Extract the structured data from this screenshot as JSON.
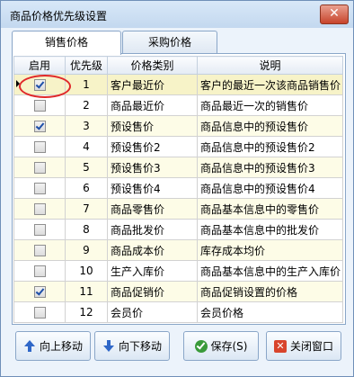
{
  "window": {
    "title": "商品价格优先级设置",
    "close_glyph": "✕"
  },
  "tabs": [
    {
      "label": "销售价格",
      "active": true
    },
    {
      "label": "采购价格",
      "active": false
    }
  ],
  "grid": {
    "columns": [
      "启用",
      "优先级",
      "价格类别",
      "说明"
    ],
    "rows": [
      {
        "enabled": true,
        "priority": "1",
        "category": "客户最近价",
        "description": "客户的最近一次该商品销售价",
        "selected": true
      },
      {
        "enabled": false,
        "priority": "2",
        "category": "商品最近价",
        "description": "商品最近一次的销售价"
      },
      {
        "enabled": true,
        "priority": "3",
        "category": "预设售价",
        "description": "商品信息中的预设售价"
      },
      {
        "enabled": false,
        "priority": "4",
        "category": "预设售价2",
        "description": "商品信息中的预设售价2"
      },
      {
        "enabled": false,
        "priority": "5",
        "category": "预设售价3",
        "description": "商品信息中的预设售价3"
      },
      {
        "enabled": false,
        "priority": "6",
        "category": "预设售价4",
        "description": "商品信息中的预设售价4"
      },
      {
        "enabled": false,
        "priority": "7",
        "category": "商品零售价",
        "description": "商品基本信息中的零售价"
      },
      {
        "enabled": false,
        "priority": "8",
        "category": "商品批发价",
        "description": "商品基本信息中的批发价"
      },
      {
        "enabled": false,
        "priority": "9",
        "category": "商品成本价",
        "description": "库存成本均价"
      },
      {
        "enabled": false,
        "priority": "10",
        "category": "生产入库价",
        "description": "商品基本信息中的生产入库价"
      },
      {
        "enabled": true,
        "priority": "11",
        "category": "商品促销价",
        "description": "商品促销设置的价格"
      },
      {
        "enabled": false,
        "priority": "12",
        "category": "会员价",
        "description": "会员价格"
      }
    ]
  },
  "buttons": {
    "move_up": "向上移动",
    "move_down": "向下移动",
    "save": "保存(S)",
    "close": "关闭窗口"
  },
  "colors": {
    "accent": "#2f67c8",
    "annotation": "#e0282a",
    "odd_row": "#fdfce7"
  }
}
